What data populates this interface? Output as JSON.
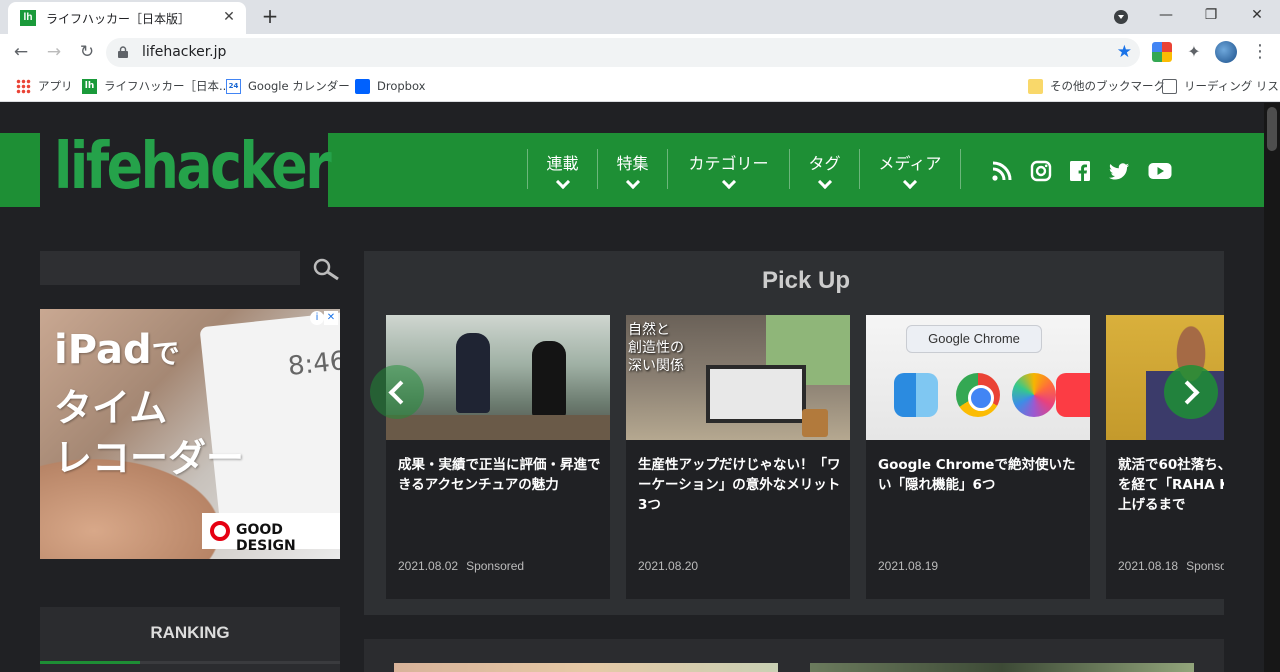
{
  "browser": {
    "tab_title": "ライフハッカー［日本版］",
    "tab_favicon": "lh",
    "url": "lifehacker.jp",
    "bookmarks": [
      {
        "label": "アプリ",
        "icon": "apps-grid-icon"
      },
      {
        "label": "ライフハッカー［日本...",
        "icon": "lifehacker-favicon"
      },
      {
        "label": "Google カレンダー",
        "icon": "google-calendar-icon",
        "icon_text": "24"
      },
      {
        "label": "Dropbox",
        "icon": "dropbox-icon"
      }
    ],
    "other_bookmarks": "その他のブックマーク",
    "reading_list": "リーディング リスト"
  },
  "site": {
    "logo": "lifehacker",
    "nav": [
      "連載",
      "特集",
      "カテゴリー",
      "タグ",
      "メディア"
    ],
    "social_icons": [
      "rss-icon",
      "instagram-icon",
      "facebook-icon",
      "twitter-icon",
      "youtube-icon"
    ],
    "brand_color": "#1e8f35"
  },
  "ad": {
    "line1_big": "iPad",
    "line1_small": "で",
    "line2": "タイム",
    "line3": "レコーダー",
    "clock": "8:46",
    "badge": "GOOD DESIGN"
  },
  "ranking": {
    "title": "RANKING"
  },
  "pickup": {
    "title": "Pick Up",
    "cards": [
      {
        "title": "成果・実績で正当に評価・昇進できるアクセンチュアの魅力",
        "date": "2021.08.02",
        "tag": "Sponsored"
      },
      {
        "title": "生産性アップだけじゃない！「ワーケーション」の意外なメリット3つ",
        "date": "2021.08.20",
        "tag": "",
        "overlay": "自然と\n創造性の\n深い関係"
      },
      {
        "title": "Google Chromeで絶対使いたい「隠れ機能」6つ",
        "date": "2021.08.19",
        "tag": "",
        "overlay": "Google Chrome"
      },
      {
        "title": "就活で60社落ち、\nを経て「RAHA K\n上げるまで",
        "date": "2021.08.18",
        "tag": "Sponso"
      }
    ]
  }
}
